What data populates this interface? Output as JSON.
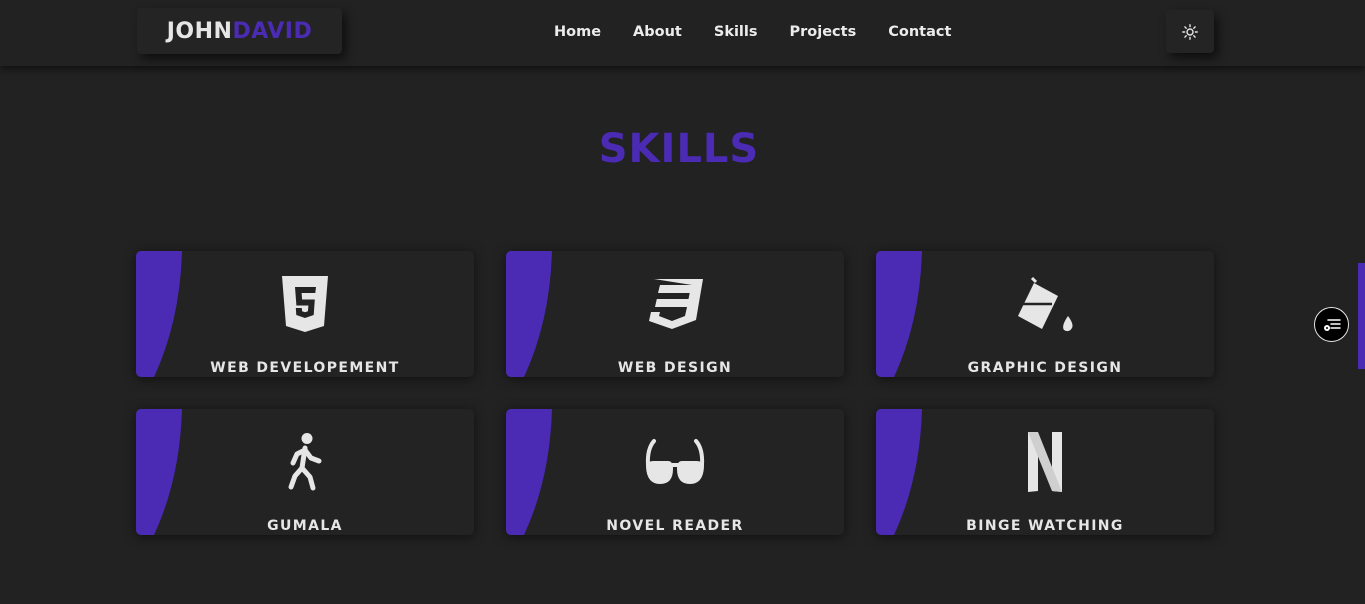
{
  "header": {
    "logo_first": "JOHN",
    "logo_last": "DAVID",
    "nav": [
      "Home",
      "About",
      "Skills",
      "Projects",
      "Contact"
    ],
    "theme_icon": "sun-icon"
  },
  "skills": {
    "title": "SKILLS",
    "cards": [
      {
        "label": "WEB DEVELOPEMENT",
        "icon": "html5-icon"
      },
      {
        "label": "WEB DESIGN",
        "icon": "css3-icon"
      },
      {
        "label": "GRAPHIC DESIGN",
        "icon": "paint-bucket-icon"
      },
      {
        "label": "GUMALA",
        "icon": "walking-person-icon"
      },
      {
        "label": "NOVEL READER",
        "icon": "glasses-icon"
      },
      {
        "label": "BINGE WATCHING",
        "icon": "netflix-icon"
      }
    ]
  },
  "side_widget": {
    "icon": "menu-settings-icon"
  },
  "colors": {
    "accent": "#4b2bb3",
    "background": "#222222",
    "card": "#232323",
    "text": "#e6e6e6"
  }
}
